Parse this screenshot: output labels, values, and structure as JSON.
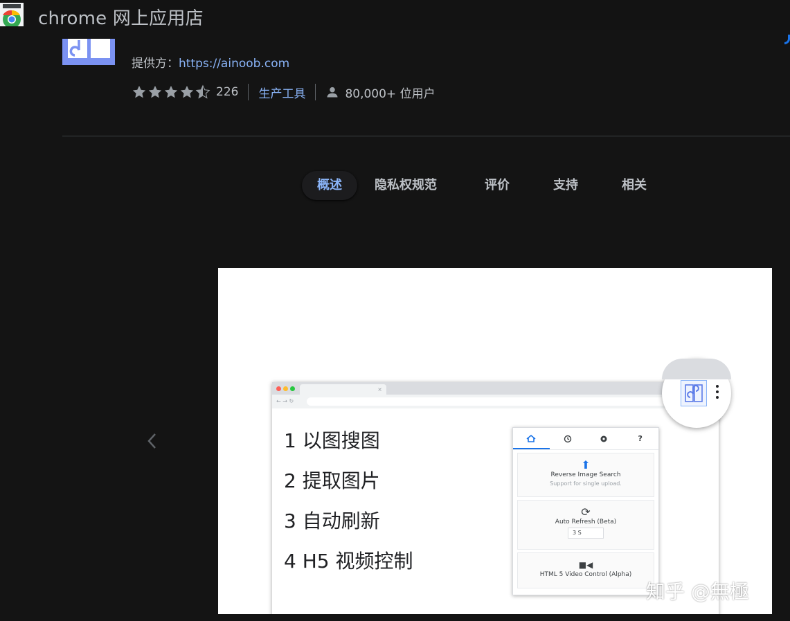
{
  "window": {
    "title": "chrome 网上应用店"
  },
  "extension": {
    "provider_label": "提供方：",
    "provider_link": "https://ainoob.com",
    "rating_count": "226",
    "category": "生产工具",
    "users": "80,000+ 位用户",
    "stars": 4.5
  },
  "tabs": [
    {
      "label": "概述",
      "active": true
    },
    {
      "label": "隐私权规范",
      "active": false
    },
    {
      "label": "评价",
      "active": false
    },
    {
      "label": "支持",
      "active": false
    },
    {
      "label": "相关",
      "active": false
    }
  ],
  "screenshot": {
    "features": [
      "1 以图搜图",
      "2 提取图片",
      "3 自动刷新",
      "4 H5 视频控制"
    ],
    "popup": {
      "tab_icons": [
        "home-icon",
        "history-icon",
        "settings-icon",
        "help-icon"
      ],
      "help_label": "?",
      "reverse_search": {
        "title": "Reverse Image Search",
        "subtitle": "Support for single upload."
      },
      "auto_refresh": {
        "title": "Auto Refresh (Beta)",
        "value": "3 S"
      },
      "video_control": {
        "title": "HTML 5 Video Control (Alpha)"
      }
    }
  },
  "watermark": "知乎 @無極",
  "colors": {
    "accent": "#8ab4f8",
    "background": "#141414",
    "icon_blue": "#7b92f2"
  }
}
